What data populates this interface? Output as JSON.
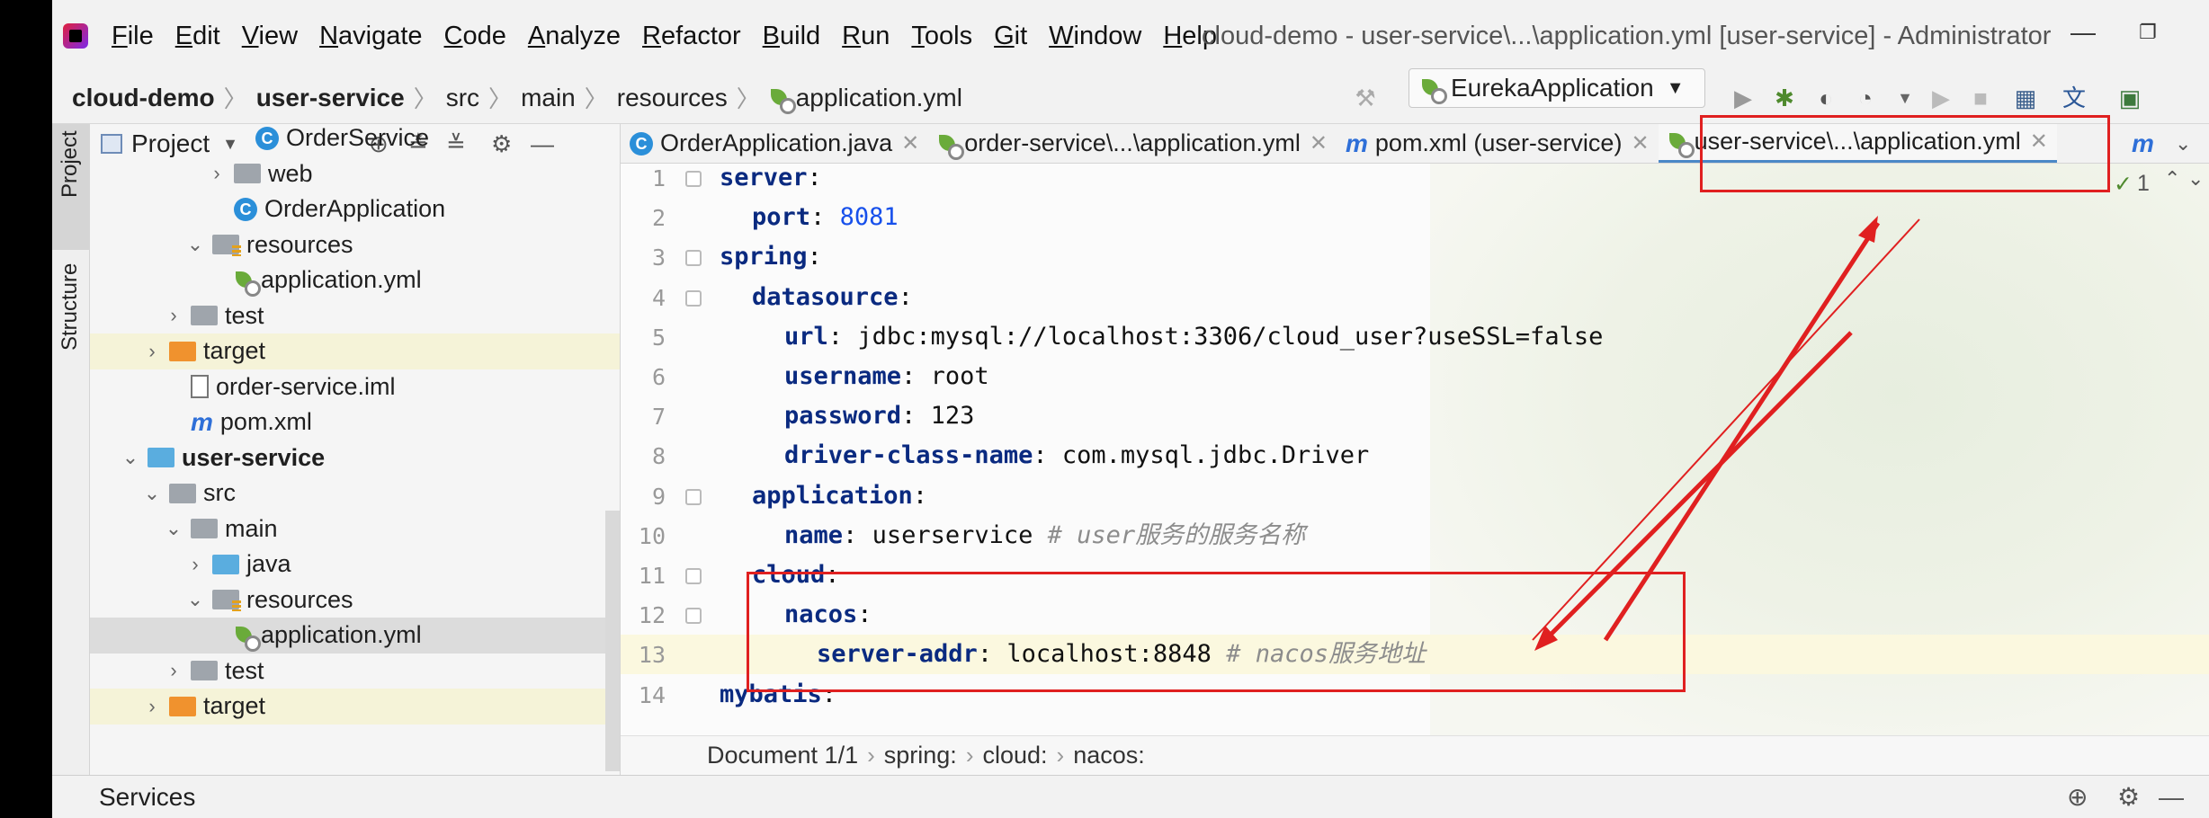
{
  "menu": [
    "File",
    "Edit",
    "View",
    "Navigate",
    "Code",
    "Analyze",
    "Refactor",
    "Build",
    "Run",
    "Tools",
    "Git",
    "Window",
    "Help"
  ],
  "window_title": "cloud-demo - user-service\\...\\application.yml [user-service] - Administrator",
  "breadcrumb": {
    "project": "cloud-demo",
    "module": "user-service",
    "src": "src",
    "main": "main",
    "resources": "resources",
    "file": "application.yml"
  },
  "run_config": "EurekaApplication",
  "tool_strip": {
    "project": "Project",
    "structure": "Structure"
  },
  "project_panel": {
    "title": "Project"
  },
  "tree": [
    {
      "label": "OrderService",
      "indent": 5,
      "icon": "class",
      "arrow": ""
    },
    {
      "label": "web",
      "indent": 4,
      "icon": "folder",
      "arrow": "›"
    },
    {
      "label": "OrderApplication",
      "indent": 4,
      "icon": "class",
      "arrow": ""
    },
    {
      "label": "resources",
      "indent": 3,
      "icon": "res-folder",
      "arrow": "⌄"
    },
    {
      "label": "application.yml",
      "indent": 4,
      "icon": "yml",
      "arrow": ""
    },
    {
      "label": "test",
      "indent": 2,
      "icon": "folder",
      "arrow": "›"
    },
    {
      "label": "target",
      "indent": 1,
      "icon": "orange-folder",
      "arrow": "›",
      "hl": true
    },
    {
      "label": "order-service.iml",
      "indent": 2,
      "icon": "file",
      "arrow": ""
    },
    {
      "label": "pom.xml",
      "indent": 2,
      "icon": "maven",
      "arrow": ""
    },
    {
      "label": "user-service",
      "indent": 0,
      "icon": "module",
      "arrow": "⌄",
      "bold": true
    },
    {
      "label": "src",
      "indent": 1,
      "icon": "folder",
      "arrow": "⌄"
    },
    {
      "label": "main",
      "indent": 2,
      "icon": "folder",
      "arrow": "⌄"
    },
    {
      "label": "java",
      "indent": 3,
      "icon": "blue-folder",
      "arrow": "›"
    },
    {
      "label": "resources",
      "indent": 3,
      "icon": "res-folder",
      "arrow": "⌄"
    },
    {
      "label": "application.yml",
      "indent": 4,
      "icon": "yml",
      "arrow": "",
      "sel": true
    },
    {
      "label": "test",
      "indent": 2,
      "icon": "folder",
      "arrow": "›"
    },
    {
      "label": "target",
      "indent": 1,
      "icon": "orange-folder",
      "arrow": "›",
      "hl": true
    }
  ],
  "tabs": [
    {
      "label": "OrderApplication.java",
      "icon": "class"
    },
    {
      "label": "order-service\\...\\application.yml",
      "icon": "yml"
    },
    {
      "label": "pom.xml (user-service)",
      "icon": "maven"
    },
    {
      "label": "user-service\\...\\application.yml",
      "icon": "yml",
      "active": true
    }
  ],
  "inspection_count": "1",
  "code_lines": [
    {
      "n": "1",
      "indent": 0,
      "key": "server",
      "val": ""
    },
    {
      "n": "2",
      "indent": 1,
      "key": "port",
      "val": "8081",
      "num": true
    },
    {
      "n": "3",
      "indent": 0,
      "key": "spring",
      "val": ""
    },
    {
      "n": "4",
      "indent": 1,
      "key": "datasource",
      "val": ""
    },
    {
      "n": "5",
      "indent": 2,
      "key": "url",
      "val": "jdbc:mysql://localhost:3306/cloud_user?useSSL=false"
    },
    {
      "n": "6",
      "indent": 2,
      "key": "username",
      "val": "root"
    },
    {
      "n": "7",
      "indent": 2,
      "key": "password",
      "val": "123"
    },
    {
      "n": "8",
      "indent": 2,
      "key": "driver-class-name",
      "val": "com.mysql.jdbc.Driver"
    },
    {
      "n": "9",
      "indent": 1,
      "key": "application",
      "val": ""
    },
    {
      "n": "10",
      "indent": 2,
      "key": "name",
      "val": "userservice",
      "comment": "# user服务的服务名称"
    },
    {
      "n": "11",
      "indent": 1,
      "key": "cloud",
      "val": ""
    },
    {
      "n": "12",
      "indent": 2,
      "key": "nacos",
      "val": ""
    },
    {
      "n": "13",
      "indent": 3,
      "key": "server-addr",
      "val": "localhost:8848",
      "comment": "# nacos服务地址",
      "current": true
    },
    {
      "n": "14",
      "indent": 0,
      "key": "mybatis",
      "val": ""
    }
  ],
  "editor_breadcrumb": [
    "Document 1/1",
    "spring:",
    "cloud:",
    "nacos:"
  ],
  "status": {
    "services": "Services"
  },
  "colors": {
    "annotation": "#e02020",
    "accent": "#4a88c7",
    "yaml_key": "#0a2a80",
    "number": "#1750eb",
    "comment": "#8c8c8c"
  }
}
